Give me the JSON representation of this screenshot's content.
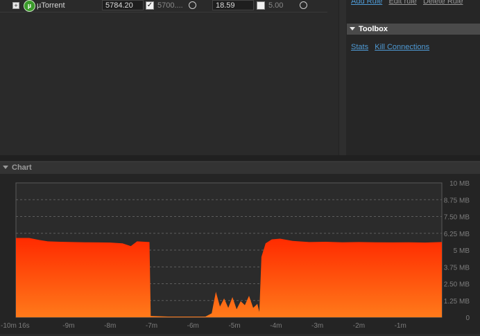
{
  "process_table": {
    "rows": [
      {
        "expander": "+",
        "icon": "utorrent-icon",
        "icon_glyph": "µ",
        "name": "µTorrent",
        "download_rate": "5784.20",
        "download_limit_checked": true,
        "download_limit": "5700....",
        "upload_rate": "18.59",
        "upload_limit_checked": false,
        "upload_limit": "5.00"
      }
    ]
  },
  "rules": {
    "add_label": "Add Rule",
    "edit_label": "Edit rule",
    "delete_label": "Delete Rule"
  },
  "toolbox": {
    "title": "Toolbox",
    "links": [
      "Stats",
      "Kill Connections"
    ]
  },
  "chart_panel": {
    "title": "Chart"
  },
  "chart_data": {
    "type": "area",
    "title": "",
    "xlabel": "",
    "ylabel": "",
    "x_unit": "minutes",
    "x_ticks": [
      {
        "value": -10.27,
        "label": "-10m 16s"
      },
      {
        "value": -9,
        "label": "-9m"
      },
      {
        "value": -8,
        "label": "-8m"
      },
      {
        "value": -7,
        "label": "-7m"
      },
      {
        "value": -6,
        "label": "-6m"
      },
      {
        "value": -5,
        "label": "-5m"
      },
      {
        "value": -4,
        "label": "-4m"
      },
      {
        "value": -3,
        "label": "-3m"
      },
      {
        "value": -2,
        "label": "-2m"
      },
      {
        "value": -1,
        "label": "-1m"
      }
    ],
    "xlim": [
      -10.27,
      0
    ],
    "y_unit": "MB",
    "y_ticks": [
      {
        "value": 0,
        "label": "0"
      },
      {
        "value": 1.25,
        "label": "1.25 MB"
      },
      {
        "value": 2.5,
        "label": "2.50 MB"
      },
      {
        "value": 3.75,
        "label": "3.75 MB"
      },
      {
        "value": 5,
        "label": "5 MB"
      },
      {
        "value": 6.25,
        "label": "6.25 MB"
      },
      {
        "value": 7.5,
        "label": "7.50 MB"
      },
      {
        "value": 8.75,
        "label": "8.75 MB"
      },
      {
        "value": 10,
        "label": "10 MB"
      }
    ],
    "ylim": [
      0,
      10
    ],
    "grid": true,
    "series": [
      {
        "color_top": "#ff2a00",
        "color_bottom": "#ff7a1a",
        "points": [
          [
            -10.27,
            5.9
          ],
          [
            -9.95,
            5.9
          ],
          [
            -9.7,
            5.75
          ],
          [
            -9.5,
            5.65
          ],
          [
            -9.2,
            5.62
          ],
          [
            -8.9,
            5.6
          ],
          [
            -8.6,
            5.58
          ],
          [
            -8.3,
            5.57
          ],
          [
            -8.0,
            5.56
          ],
          [
            -7.7,
            5.5
          ],
          [
            -7.5,
            5.3
          ],
          [
            -7.35,
            5.65
          ],
          [
            -7.05,
            5.6
          ],
          [
            -7.02,
            0.1
          ],
          [
            -6.6,
            0.05
          ],
          [
            -6.0,
            0.05
          ],
          [
            -5.7,
            0.05
          ],
          [
            -5.55,
            0.3
          ],
          [
            -5.45,
            1.9
          ],
          [
            -5.35,
            0.8
          ],
          [
            -5.25,
            1.4
          ],
          [
            -5.15,
            0.7
          ],
          [
            -5.05,
            1.5
          ],
          [
            -4.95,
            0.6
          ],
          [
            -4.85,
            1.2
          ],
          [
            -4.75,
            0.9
          ],
          [
            -4.65,
            1.6
          ],
          [
            -4.55,
            0.7
          ],
          [
            -4.45,
            1.0
          ],
          [
            -4.4,
            0.4
          ],
          [
            -4.35,
            4.5
          ],
          [
            -4.25,
            5.5
          ],
          [
            -4.1,
            5.8
          ],
          [
            -3.9,
            5.85
          ],
          [
            -3.6,
            5.68
          ],
          [
            -3.2,
            5.6
          ],
          [
            -2.8,
            5.62
          ],
          [
            -2.4,
            5.58
          ],
          [
            -2.0,
            5.6
          ],
          [
            -1.6,
            5.58
          ],
          [
            -1.2,
            5.57
          ],
          [
            -0.8,
            5.58
          ],
          [
            -0.4,
            5.56
          ],
          [
            0,
            5.6
          ]
        ]
      }
    ]
  }
}
